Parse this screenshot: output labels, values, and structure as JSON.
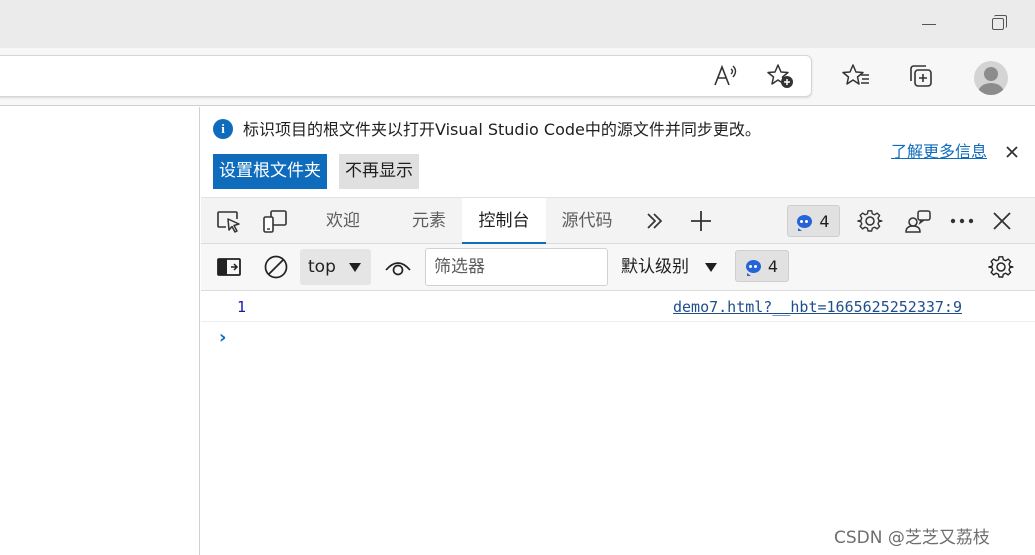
{
  "browser": {
    "icons": [
      "minimize-icon",
      "restore-icon",
      "read-aloud-icon",
      "add-favorite-icon",
      "favorites-icon",
      "collections-icon",
      "profile-avatar"
    ]
  },
  "infobar": {
    "message": "标识项目的根文件夹以打开Visual Studio Code中的源文件并同步更改。",
    "set_root_button": "设置根文件夹",
    "dont_show_button": "不再显示",
    "learn_more_link": "了解更多信息"
  },
  "devtools": {
    "tabs": [
      {
        "label": "欢迎",
        "active": false
      },
      {
        "label": "元素",
        "active": false
      },
      {
        "label": "控制台",
        "active": true
      },
      {
        "label": "源代码",
        "active": false
      }
    ],
    "issues_count": "4",
    "accent_color": "#0f6cbd"
  },
  "console": {
    "context": "top",
    "filter_placeholder": "筛选器",
    "level": "默认级别",
    "message_count": "4",
    "logs": [
      {
        "value": "1",
        "source": "demo7.html?__hbt=1665625252337:9"
      }
    ],
    "prompt_symbol": "›"
  },
  "watermark": "CSDN @芝芝又荔枝"
}
